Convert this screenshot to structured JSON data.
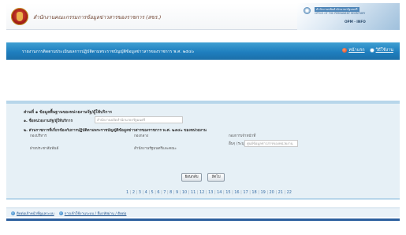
{
  "header": {
    "site_title": "สำนักงานคณะกรรมการข้อมูลข่าวสารของราชการ (สขร.)",
    "ministry": {
      "line1": "สำนักงานปลัดสำนักนายกรัฐมนตรี",
      "line2": "OFFICE OF THE PERMANENT SECRETARY",
      "line3": "OPM · INFO"
    }
  },
  "banner": {
    "title": "รายงานการติดตามประเมินผลการปฏิบัติตามพระราชบัญญัติข้อมูลข่าวสารของราชการ พ.ศ. ๒๕๔๐",
    "links": [
      {
        "label": "หน้าแรก",
        "icon": "home-dot-icon"
      },
      {
        "label": "วิธีใช้งาน",
        "icon": "help-dot-icon"
      }
    ]
  },
  "form": {
    "section_title": "ส่วนที่ ๑ ข้อมูลพื้นฐานของหน่วยงานรัฐ/ผู้ให้บริการ",
    "field1_label": "๑. ชื่อหน่วยงานรัฐ/ผู้ให้บริการ",
    "field1_placeholder": "สำนักงานปลัดสำนักนายกรัฐมนตรี",
    "field2_label": "๒. ส่วนราชการที่เกี่ยวข้องกับการปฏิบัติตามพระราชบัญญัติข้อมูลข่าวสารของราชการ พ.ศ. ๒๕๔๐ ของหน่วยงาน",
    "columns": [
      "กองบริหาร",
      "กองกลาง",
      "กองการเจ้าหน้าที่"
    ],
    "rows": [
      "ฝ่ายประชาสัมพันธ์",
      "สำนักงานรัฐมนตรีและคณะ"
    ],
    "other_label": "อื่นๆ (ระบุ)",
    "other_placeholder": "ศูนย์ข้อมูลข่าวสารของหน่วยงาน",
    "buttons": {
      "back": "ย้อนกลับ",
      "next": "ถัดไป"
    }
  },
  "pager": {
    "pages": [
      "1",
      "2",
      "3",
      "4",
      "5",
      "6",
      "7",
      "8",
      "9",
      "10",
      "11",
      "12",
      "13",
      "14",
      "15",
      "16",
      "17",
      "18",
      "19",
      "20",
      "21",
      "22"
    ]
  },
  "footer": {
    "links": [
      {
        "label": "ติดต่อเจ้าหน้าที่ดูแลระบบ",
        "icon": "contact-dot-icon"
      },
      {
        "label": "การเข้าใช้งานระบบ / ลืมรหัสผ่าน / ติดต่อ",
        "icon": "info-dot-icon"
      }
    ]
  }
}
